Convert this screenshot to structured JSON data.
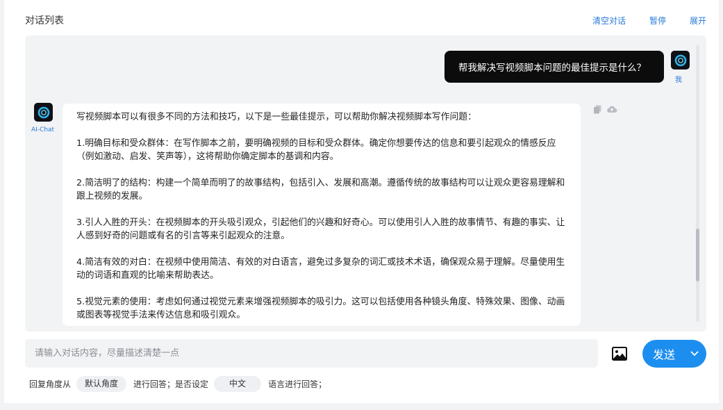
{
  "header": {
    "title": "对话列表",
    "actions": [
      "清空对话",
      "暂停",
      "展开"
    ]
  },
  "user_message": {
    "name": "我",
    "text": "帮我解决写视频脚本问题的最佳提示是什么？"
  },
  "ai_message": {
    "name": "AI-Chat",
    "paragraphs": [
      "写视频脚本可以有很多不同的方法和技巧，以下是一些最佳提示，可以帮助你解决视频脚本写作问题：",
      "1.明确目标和受众群体：在写作脚本之前，要明确视频的目标和受众群体。确定你想要传达的信息和要引起观众的情感反应（例如激动、启发、笑声等），这将帮助你确定脚本的基调和内容。",
      "2.简洁明了的结构：构建一个简单而明了的故事结构，包括引入、发展和高潮。遵循传统的故事结构可以让观众更容易理解和跟上视频的发展。",
      "3.引人入胜的开头：在视频脚本的开头吸引观众，引起他们的兴趣和好奇心。可以使用引人入胜的故事情节、有趣的事实、让人感到好奇的问题或有名的引言等来引起观众的注意。",
      "4.简洁有效的对白：在视频中使用简洁、有效的对白语言，避免过多复杂的词汇或技术术语，确保观众易于理解。尽量使用生动的词语和直观的比喻来帮助表达。",
      "5.视觉元素的使用：考虑如何通过视觉元素来增强视频脚本的吸引力。这可以包括使用各种镜头角度、特殊效果、图像、动画或图表等视觉手法来传达信息和吸引观众。"
    ]
  },
  "input": {
    "placeholder": "请输入对话内容，尽量描述清楚一点"
  },
  "send": {
    "label": "发送"
  },
  "options": {
    "text1": "回复角度从",
    "angle": "默认角度",
    "text2": "进行回答；是否设定",
    "language": "中文",
    "text3": "语言进行回答；"
  },
  "icons": {
    "avatar": "openai-logo-icon",
    "copy": "copy-icon",
    "cloud": "cloud-upload-icon",
    "image": "image-icon",
    "caret": "chevron-down-icon"
  },
  "colors": {
    "accent": "#1c8ef0",
    "link": "#2a7ad8",
    "user_bubble": "#0c0c0c"
  }
}
